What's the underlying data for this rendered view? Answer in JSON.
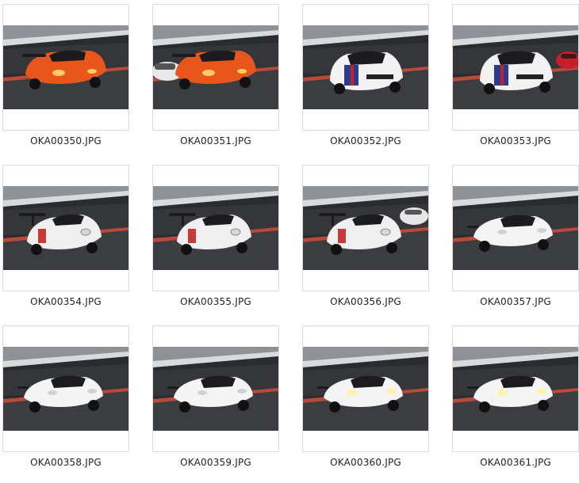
{
  "gallery": {
    "items": [
      {
        "filename": "OKA00350.JPG",
        "car": "orange-sports-car",
        "body": "#e8561c",
        "extra": "none"
      },
      {
        "filename": "OKA00351.JPG",
        "car": "orange-sports-car",
        "body": "#e8561c",
        "extra": "white-car-left"
      },
      {
        "filename": "OKA00352.JPG",
        "car": "white-hatchback-racer",
        "body": "#f2f2f2",
        "extra": "none"
      },
      {
        "filename": "OKA00353.JPG",
        "car": "white-hatchback-racer",
        "body": "#f2f2f2",
        "extra": "red-car-right"
      },
      {
        "filename": "OKA00354.JPG",
        "car": "white-porsche-wing",
        "body": "#efefef",
        "extra": "none"
      },
      {
        "filename": "OKA00355.JPG",
        "car": "white-porsche-wing",
        "body": "#efefef",
        "extra": "none"
      },
      {
        "filename": "OKA00356.JPG",
        "car": "white-porsche-wing",
        "body": "#efefef",
        "extra": "white-car-right"
      },
      {
        "filename": "OKA00357.JPG",
        "car": "white-porsche",
        "body": "#f4f4f4",
        "extra": "none"
      },
      {
        "filename": "OKA00358.JPG",
        "car": "white-porsche",
        "body": "#f4f4f4",
        "extra": "none"
      },
      {
        "filename": "OKA00359.JPG",
        "car": "white-porsche",
        "body": "#f4f4f4",
        "extra": "none"
      },
      {
        "filename": "OKA00360.JPG",
        "car": "white-porsche-lights",
        "body": "#f4f4f4",
        "extra": "none"
      },
      {
        "filename": "OKA00361.JPG",
        "car": "white-porsche-lights",
        "body": "#f4f4f4",
        "extra": "none"
      }
    ]
  }
}
